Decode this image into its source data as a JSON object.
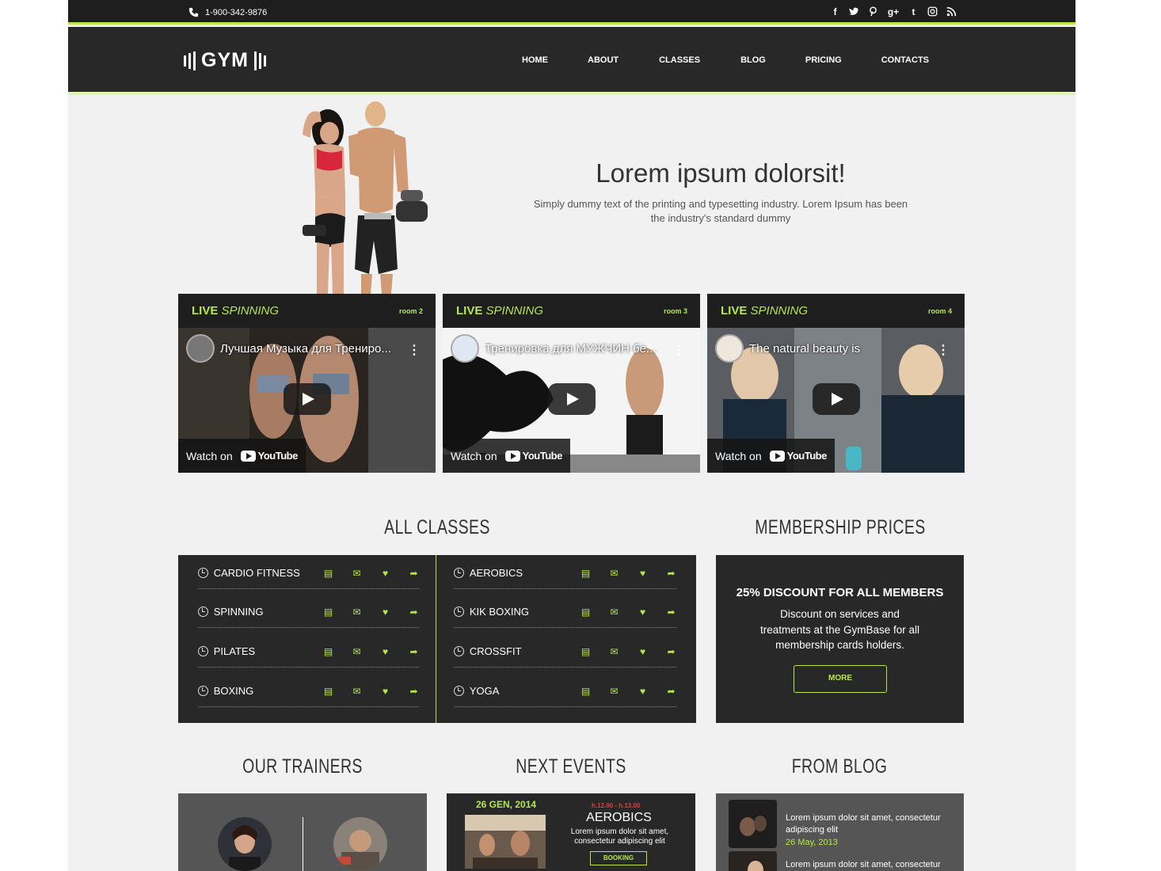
{
  "topbar": {
    "phone": "1-900-342-9876",
    "social": [
      "facebook-icon",
      "twitter-icon",
      "pinterest-icon",
      "google-plus-icon",
      "tumblr-icon",
      "instagram-icon",
      "rss-icon"
    ]
  },
  "header": {
    "logo": "GYM",
    "nav": [
      "HOME",
      "ABOUT",
      "CLASSES",
      "BLOG",
      "PRICING",
      "CONTACTS"
    ]
  },
  "hero": {
    "title": "Lorem ipsum dolorsit!",
    "subtitle": "Simply dummy text of the printing and typesetting industry. Lorem Ipsum has been the industry's standard dummy"
  },
  "videos": [
    {
      "title_live": "LIVE",
      "title_em": "SPINNING",
      "room": "room 2",
      "video_title": "Лучшая Музыка для Трениро...",
      "watch": "Watch on",
      "yt": "YouTube"
    },
    {
      "title_live": "LIVE",
      "title_em": "SPINNING",
      "room": "room 3",
      "video_title": "Тренировка для МУЖЧИН бе...",
      "watch": "Watch on",
      "yt": "YouTube"
    },
    {
      "title_live": "LIVE",
      "title_em": "SPINNING",
      "room": "room 4",
      "video_title": "The natural beauty is",
      "watch": "Watch on",
      "yt": "YouTube"
    }
  ],
  "sections": {
    "classes": "ALL CLASSES",
    "membership": "MEMBERSHIP PRICES",
    "trainers": "OUR TRAINERS",
    "events": "NEXT EVENTS",
    "blog": "FROM BLOG"
  },
  "classes": {
    "left": [
      "CARDIO FITNESS",
      "SPINNING",
      "PILATES",
      "BOXING"
    ],
    "right": [
      "AEROBICS",
      "KIK BOXING",
      "CROSSFIT",
      "YOGA"
    ]
  },
  "membership": {
    "title": "25% DISCOUNT FOR ALL MEMBERS",
    "text": "Discount on services and treatments at the GymBase for all membership cards holders.",
    "button": "MORE"
  },
  "event": {
    "date": "26 GEN, 2014",
    "time": "h.12.00 - h.13.00",
    "name": "AEROBICS",
    "text": "Lorem ipsum dolor sit amet, consectetur adipiscing elit",
    "button": "BOOKING"
  },
  "blog": [
    {
      "text": "Lorem ipsum dolor sit amet, consectetur adipiscing elit",
      "date": "26 May, 2013"
    },
    {
      "text": "Lorem ipsum dolor sit amet, consectetur",
      "date": ""
    }
  ],
  "colors": {
    "accent": "#b5e64c",
    "dark": "#282828",
    "bg": "#f1f1f1"
  }
}
